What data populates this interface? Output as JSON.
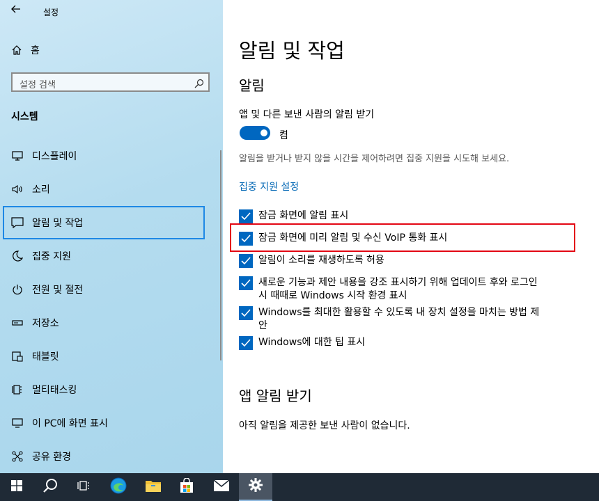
{
  "window": {
    "title": "설정"
  },
  "sidebar": {
    "home_label": "홈",
    "search_placeholder": "설정 검색",
    "category": "시스템",
    "items": [
      {
        "label": "디스플레이",
        "icon": "monitor-icon"
      },
      {
        "label": "소리",
        "icon": "speaker-icon"
      },
      {
        "label": "알림 및 작업",
        "icon": "notification-icon",
        "selected": true
      },
      {
        "label": "집중 지원",
        "icon": "moon-icon"
      },
      {
        "label": "전원 및 절전",
        "icon": "power-icon"
      },
      {
        "label": "저장소",
        "icon": "storage-icon"
      },
      {
        "label": "태블릿",
        "icon": "tablet-icon"
      },
      {
        "label": "멀티태스킹",
        "icon": "multitasking-icon"
      },
      {
        "label": "이 PC에 화면 표시",
        "icon": "project-icon"
      },
      {
        "label": "공유 환경",
        "icon": "share-icon"
      }
    ]
  },
  "main": {
    "page_title": "알림 및 작업",
    "notifications_heading": "알림",
    "get_notifications_label": "앱 및 다른 보낸 사람의 알림 받기",
    "toggle_state": "켬",
    "focus_desc": "알림을 받거나 받지 않을 시간을 제어하려면 집중 지원을 시도해 보세요.",
    "focus_link": "집중 지원 설정",
    "checkboxes": [
      {
        "label": "잠금 화면에 알림 표시",
        "checked": true
      },
      {
        "label": "잠금 화면에 미리 알림 및 수신 VoIP 통화 표시",
        "checked": true
      },
      {
        "label": "알림이 소리를 재생하도록 허용",
        "checked": true
      },
      {
        "label": "새로운 기능과 제안 내용을 강조 표시하기 위해 업데이트 후와 로그인 시 때때로 Windows 시작 환경 표시",
        "checked": true
      },
      {
        "label": "Windows를 최대한 활용할 수 있도록 내 장치 설정을 마치는 방법 제안",
        "checked": true
      },
      {
        "label": "Windows에 대한 팁 표시",
        "checked": true
      }
    ],
    "app_notifications_heading": "앱 알림 받기",
    "no_senders": "아직 알림을 제공한 보낸 사람이 없습니다."
  },
  "taskbar": {
    "items": [
      "start-icon",
      "search-icon",
      "task-view-icon",
      "edge-icon",
      "file-explorer-icon",
      "store-icon",
      "mail-icon",
      "settings-icon"
    ],
    "active": "settings-icon"
  },
  "colors": {
    "accent": "#0067c0",
    "link": "#0066b4",
    "highlight": "#e30613",
    "taskbar": "#1f2a36"
  }
}
